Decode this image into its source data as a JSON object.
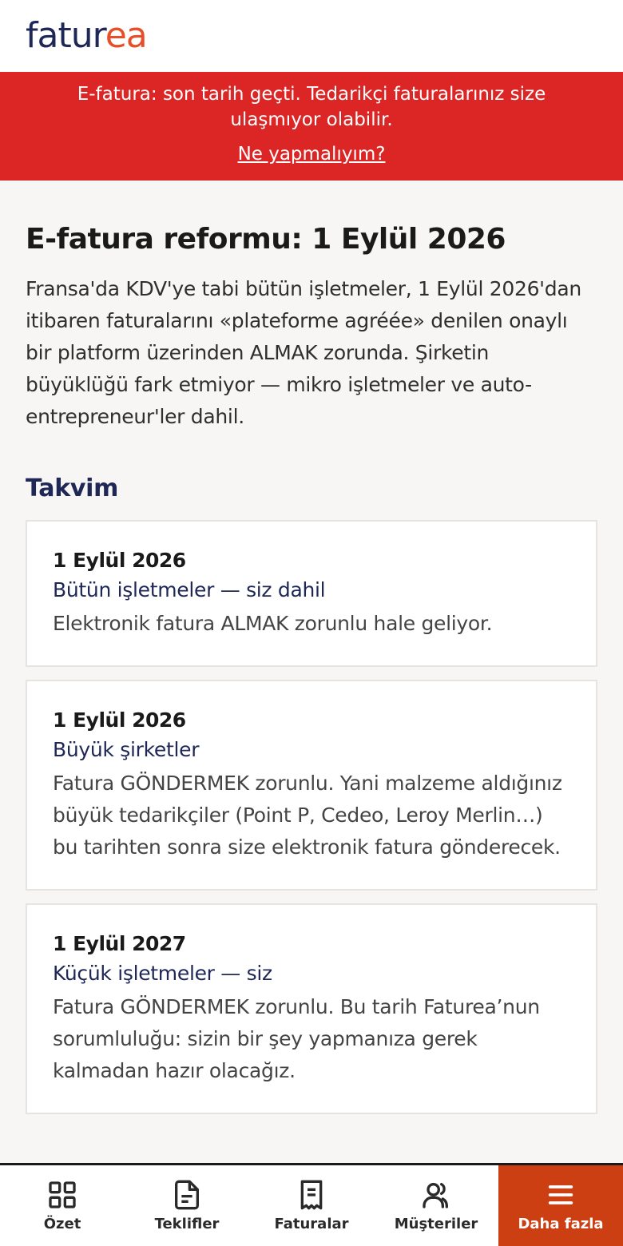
{
  "brand": {
    "logo_part1": "fatur",
    "logo_part2": "ea",
    "colors": {
      "navy": "#1e2755",
      "orange": "#e5502a",
      "alert_red": "#dc2626",
      "active_nav": "#cc3f12"
    }
  },
  "banner": {
    "text": "E-fatura: son tarih geçti. Tedarikçi faturalarınız size ulaşmıyor olabilir.",
    "link": "Ne yapmalıyım?"
  },
  "main": {
    "title": "E-fatura reformu: 1 Eylül 2026",
    "intro": "Fransa'da KDV'ye tabi bütün işletmeler, 1 Eylül 2026'dan itibaren faturalarını «plateforme agréée» denilen onaylı bir platform üzerinden ALMAK zorunda. Şirketin büyüklüğü fark etmiyor — mikro işletmeler ve auto-entrepreneur'ler dahil.",
    "section_title": "Takvim",
    "timeline": [
      {
        "date": "1 Eylül 2026",
        "who": "Bütün işletmeler — siz dahil",
        "desc": "Elektronik fatura ALMAK zorunlu hale geliyor."
      },
      {
        "date": "1 Eylül 2026",
        "who": "Büyük şirketler",
        "desc": "Fatura GÖNDERMEK zorunlu. Yani malzeme aldığınız büyük tedarikçiler (Point P, Cedeo, Leroy Merlin…) bu tarihten sonra size elektronik fatura gönderecek."
      },
      {
        "date": "1 Eylül 2027",
        "who": "Küçük işletmeler — siz",
        "desc": "Fatura GÖNDERMEK zorunlu. Bu tarih Faturea’nun sorumluluğu: sizin bir şey yapmanıza gerek kalmadan hazır olacağız."
      }
    ]
  },
  "nav": {
    "items": [
      {
        "label": "Özet",
        "icon": "grid-icon"
      },
      {
        "label": "Teklifler",
        "icon": "document-icon"
      },
      {
        "label": "Faturalar",
        "icon": "receipt-icon"
      },
      {
        "label": "Müşteriler",
        "icon": "users-icon"
      },
      {
        "label": "Daha fazla",
        "icon": "menu-icon",
        "active": true
      }
    ]
  }
}
